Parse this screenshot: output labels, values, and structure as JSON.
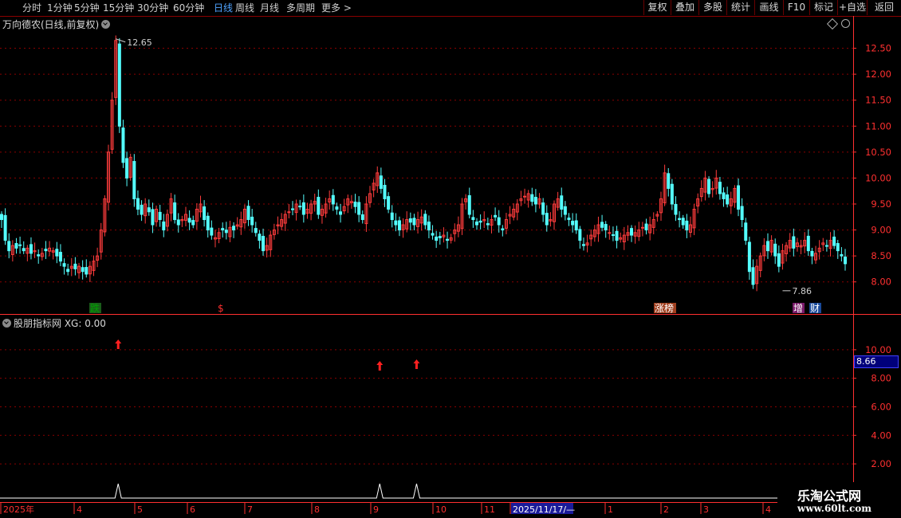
{
  "toolbar": {
    "periods": [
      "分时",
      "1分钟",
      "5分钟",
      "15分钟",
      "30分钟",
      "60分钟",
      "日线",
      "周线",
      "月线",
      "多周期",
      "更多 >"
    ],
    "active_period": "日线",
    "buttons": [
      "复权",
      "叠加",
      "多股",
      "统计",
      "画线",
      "F10",
      "标记",
      "+自选",
      "返回"
    ]
  },
  "stock_title": "万向德农(日线,前复权)",
  "indicator_title": "股朋指标网  XG: 0.00",
  "price_axis_ticks": [
    "12.50",
    "12.00",
    "11.50",
    "11.00",
    "10.50",
    "10.00",
    "9.50",
    "9.00",
    "8.50",
    "8.00"
  ],
  "indicator_axis_ticks": [
    "10.00",
    "8.00",
    "6.00",
    "4.00",
    "2.00"
  ],
  "current_value": "8.66",
  "date_axis": [
    "2025年",
    "4",
    "5",
    "6",
    "7",
    "8",
    "9",
    "10",
    "11",
    "2025/11/17/—",
    "1",
    "2",
    "3",
    "4"
  ],
  "high_label": "12.65",
  "low_label": "7.86",
  "event_tags": [
    {
      "text": "跌",
      "color": "#00a000",
      "bg": "#1a5c1a"
    },
    {
      "text": "$",
      "color": "#ff3030",
      "bg": "none"
    },
    {
      "text": "涨榜",
      "color": "#ffffff",
      "bg": "#a04020"
    },
    {
      "text": "增",
      "color": "#ffffff",
      "bg": "#7a1a6a"
    },
    {
      "text": "财",
      "color": "#ffffff",
      "bg": "#1a4a9a"
    }
  ],
  "watermark": {
    "line1": "乐淘公式网",
    "line2": "www.60lt.com"
  },
  "colors": {
    "up": "#ff3c3c",
    "down": "#54ffff",
    "grid": "#8a0000",
    "axis": "#ff3030",
    "signal": "#ff2020"
  },
  "chart_data": {
    "type": "candlestick",
    "y_range": [
      7.75,
      12.8
    ],
    "closes": [
      9.2,
      8.8,
      8.6,
      8.7,
      8.65,
      8.7,
      8.6,
      8.65,
      8.55,
      8.6,
      8.5,
      8.55,
      8.6,
      8.65,
      8.6,
      8.5,
      8.4,
      8.3,
      8.2,
      8.3,
      8.25,
      8.3,
      8.2,
      8.15,
      8.3,
      8.4,
      8.5,
      9.0,
      9.6,
      10.5,
      11.5,
      12.65,
      11.0,
      10.3,
      10.0,
      10.4,
      9.6,
      9.4,
      9.3,
      9.5,
      9.35,
      9.1,
      9.4,
      9.2,
      9.0,
      9.3,
      9.6,
      9.2,
      9.1,
      9.2,
      9.3,
      9.15,
      9.1,
      9.4,
      9.5,
      9.2,
      9.0,
      8.9,
      8.85,
      8.95,
      9.0,
      8.95,
      9.05,
      9.0,
      9.1,
      9.2,
      9.4,
      9.2,
      9.1,
      8.95,
      8.8,
      8.6,
      8.7,
      8.9,
      9.0,
      9.1,
      9.2,
      9.3,
      9.35,
      9.4,
      9.5,
      9.45,
      9.3,
      9.4,
      9.5,
      9.55,
      9.3,
      9.4,
      9.5,
      9.6,
      9.5,
      9.4,
      9.3,
      9.45,
      9.6,
      9.55,
      9.45,
      9.3,
      9.2,
      9.5,
      9.7,
      9.9,
      10.1,
      9.8,
      9.6,
      9.4,
      9.2,
      9.1,
      9.0,
      9.1,
      9.2,
      9.15,
      9.1,
      9.2,
      9.25,
      9.1,
      9.0,
      8.9,
      8.8,
      8.85,
      8.9,
      8.8,
      8.85,
      9.0,
      9.1,
      9.5,
      9.6,
      9.3,
      9.2,
      9.1,
      9.15,
      9.2,
      9.1,
      9.2,
      9.25,
      9.1,
      9.0,
      9.2,
      9.3,
      9.4,
      9.5,
      9.6,
      9.65,
      9.7,
      9.55,
      9.5,
      9.6,
      9.3,
      9.1,
      9.2,
      9.5,
      9.6,
      9.4,
      9.3,
      9.2,
      9.1,
      9.0,
      8.8,
      8.7,
      8.75,
      8.9,
      9.0,
      9.1,
      9.05,
      9.0,
      8.95,
      8.9,
      8.8,
      8.85,
      8.9,
      8.95,
      8.9,
      8.95,
      9.0,
      9.05,
      9.0,
      9.1,
      9.2,
      9.3,
      9.6,
      10.1,
      9.8,
      9.5,
      9.3,
      9.2,
      9.1,
      9.0,
      9.1,
      9.4,
      9.6,
      9.8,
      10.0,
      9.7,
      9.8,
      10.0,
      9.7,
      9.6,
      9.5,
      9.6,
      9.8,
      9.4,
      9.2,
      8.8,
      8.2,
      7.95,
      8.3,
      8.5,
      8.7,
      8.6,
      8.8,
      8.5,
      8.3,
      8.6,
      8.7,
      8.8,
      8.65,
      8.75,
      8.7,
      8.8,
      8.6,
      8.5,
      8.55,
      8.65,
      8.75,
      8.7,
      8.8,
      8.7,
      8.6,
      8.5,
      8.35
    ],
    "signal_indices": [
      31,
      102,
      112
    ],
    "high_index": 31,
    "low_index": 212
  }
}
